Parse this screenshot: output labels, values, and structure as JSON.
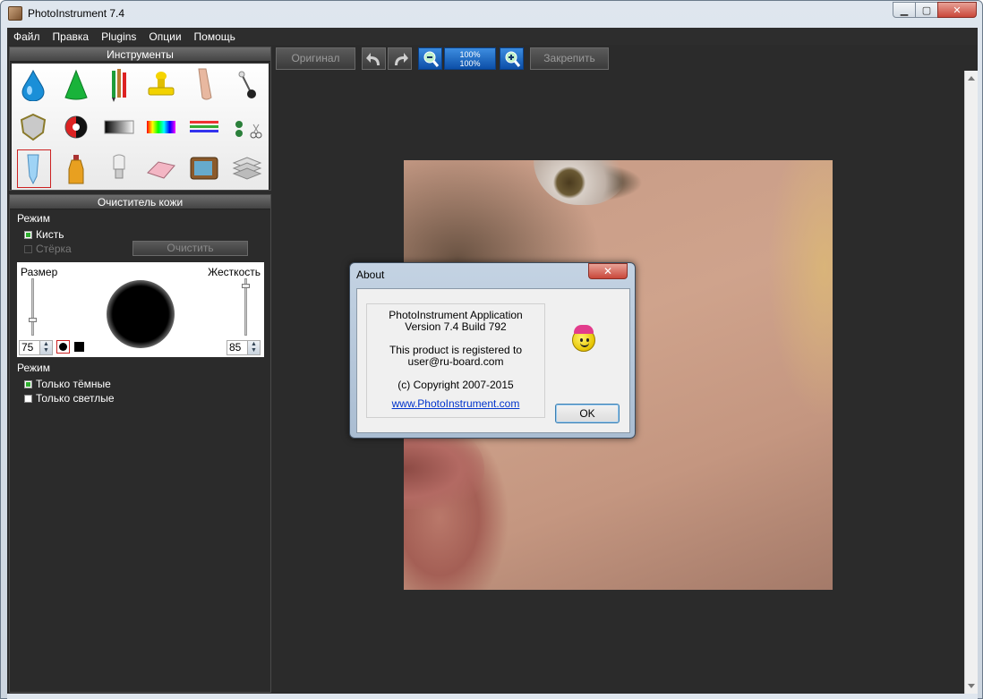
{
  "window": {
    "title": "PhotoInstrument 7.4",
    "controls": {
      "minimize": "▁",
      "maximize": "▢",
      "close": "✕"
    }
  },
  "menu": {
    "items": [
      "Файл",
      "Правка",
      "Plugins",
      "Опции",
      "Помощь"
    ]
  },
  "tools_panel": {
    "title": "Инструменты",
    "tools": [
      "drop-icon",
      "cone-icon",
      "pencils-icon",
      "stamp-icon",
      "finger-icon",
      "pin-icon",
      "shield-icon",
      "contrast-icon",
      "gradient-icon",
      "rainbow-icon",
      "lines-icon",
      "scissors-icon",
      "skin-cleaner-icon",
      "bottle-icon",
      "bulb-icon",
      "eraser-icon",
      "tv-icon",
      "text-layers-icon"
    ],
    "selected_index": 12
  },
  "skin_panel": {
    "title": "Очиститель кожи",
    "mode_label": "Режим",
    "brush_label": "Кисть",
    "eraser_label": "Стёрка",
    "clear_label": "Очистить",
    "size_label": "Размер",
    "hardness_label": "Жесткость",
    "size_value": "75",
    "hardness_value": "85",
    "mode2_label": "Режим",
    "only_dark_label": "Только тёмные",
    "only_light_label": "Только светлые",
    "brush_checked": true,
    "eraser_checked": false,
    "only_dark_checked": true,
    "only_light_checked": false
  },
  "toolbar": {
    "original_label": "Оригинал",
    "zoom_100_top": "100%",
    "zoom_100_bottom": "100%",
    "pin_label": "Закрепить"
  },
  "about": {
    "title": "About",
    "close": "✕",
    "app_name": "PhotoInstrument Application",
    "version": "Version 7.4 Build 792",
    "registered_to": "This product is registered to",
    "user": "user@ru-board.com",
    "copyright": "(c) Copyright 2007-2015",
    "website": "www.PhotoInstrument.com",
    "ok_label": "OK"
  },
  "colors": {
    "panel_bg": "#2b2b2b",
    "accent_green": "#2fae2f",
    "selection_red": "#cc2222",
    "dialog_link": "#0033cc"
  }
}
